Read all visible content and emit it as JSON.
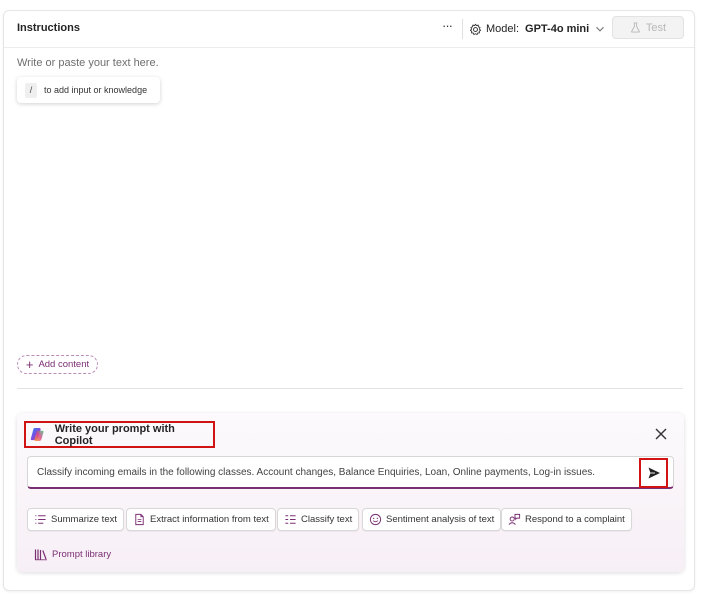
{
  "header": {
    "title": "Instructions",
    "more_label": "···",
    "model_label": "Model:",
    "model_value": "GPT-4o mini",
    "test_label": "Test"
  },
  "editor": {
    "placeholder": "Write or paste your text here.",
    "hint_key": "/",
    "hint_text": "to add input or knowledge",
    "add_content_label": "Add content"
  },
  "copilot": {
    "title": "Write your prompt with Copilot",
    "prompt_value": "Classify incoming emails in the following classes. Account changes, Balance Enquiries, Loan, Online payments, Log-in issues.",
    "suggestions": [
      {
        "label": "Summarize text",
        "icon": "list-icon"
      },
      {
        "label": "Extract information from text",
        "icon": "document-extract-icon"
      },
      {
        "label": "Classify text",
        "icon": "classify-list-icon"
      },
      {
        "label": "Sentiment analysis of text",
        "icon": "smiley-icon"
      },
      {
        "label": "Respond to a complaint",
        "icon": "person-feedback-icon"
      }
    ],
    "library_label": "Prompt library"
  },
  "colors": {
    "accent": "#7a2e72",
    "highlight": "#d01414",
    "muted": "#b8b8b8"
  }
}
